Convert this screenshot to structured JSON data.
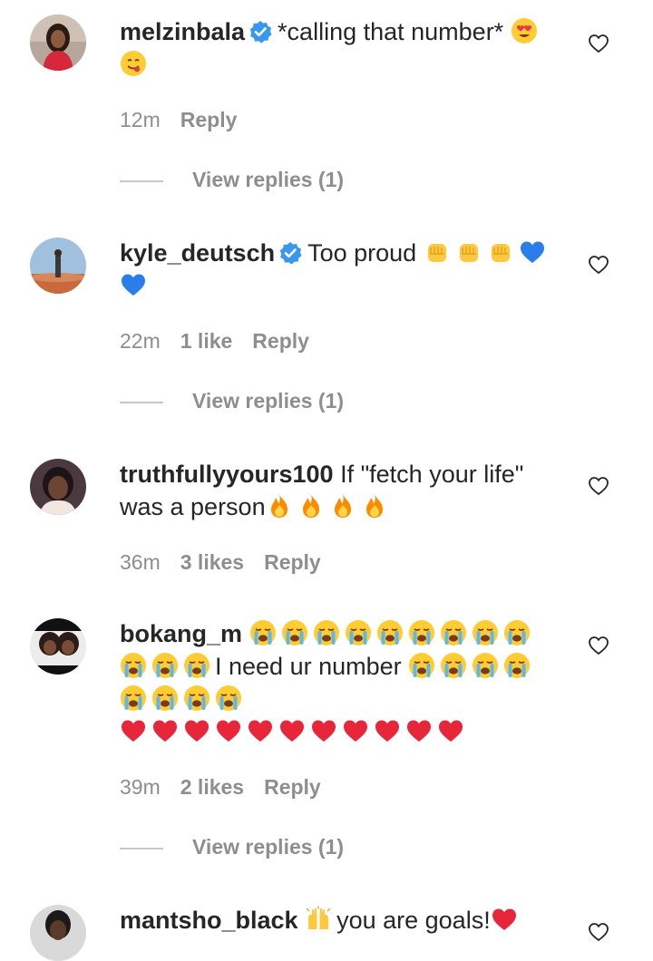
{
  "comments": [
    {
      "username": "melzinbala",
      "verified": true,
      "text": "*calling that number*",
      "time": "12m",
      "likes": "",
      "reply": "Reply",
      "view_replies": "View replies (1)"
    },
    {
      "username": "kyle_deutsch",
      "verified": true,
      "text": "Too proud",
      "time": "22m",
      "likes": "1 like",
      "reply": "Reply",
      "view_replies": "View replies (1)"
    },
    {
      "username": "truthfullyyours100",
      "verified": false,
      "text": "If \"fetch your life\" was a person",
      "time": "36m",
      "likes": "3 likes",
      "reply": "Reply",
      "view_replies": ""
    },
    {
      "username": "bokang_m",
      "verified": false,
      "text": "I need ur number",
      "time": "39m",
      "likes": "2 likes",
      "reply": "Reply",
      "view_replies": "View replies (1)"
    },
    {
      "username": "mantsho_black",
      "verified": false,
      "text": "you are goals!",
      "time": "",
      "likes": "",
      "reply": "",
      "view_replies": ""
    }
  ],
  "colors": {
    "verified": "#3897f0",
    "secondary_text": "#8e8e8e",
    "primary_text": "#262626"
  },
  "icons": [
    "verified-badge-icon",
    "heart-outline-icon",
    "heart-eyes-emoji",
    "yum-emoji",
    "raised-fist-emoji",
    "blue-heart-emoji",
    "fire-emoji",
    "crying-face-emoji",
    "red-heart-emoji",
    "raising-hands-emoji"
  ]
}
